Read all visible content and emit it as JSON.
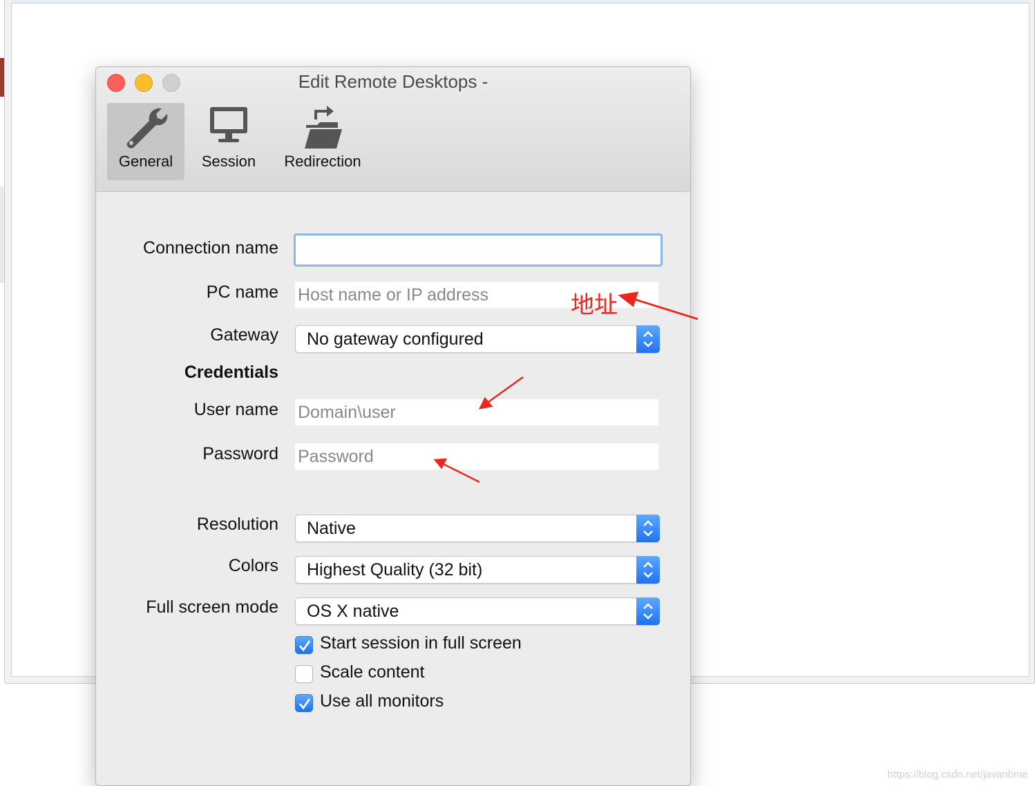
{
  "window": {
    "title": "Edit Remote Desktops -"
  },
  "toolbar": {
    "items": [
      {
        "label": "General",
        "icon": "wrench-icon",
        "active": true
      },
      {
        "label": "Session",
        "icon": "monitor-icon",
        "active": false
      },
      {
        "label": "Redirection",
        "icon": "folder-redirect-icon",
        "active": false
      }
    ]
  },
  "form": {
    "connection_name": {
      "label": "Connection name",
      "value": "",
      "placeholder": ""
    },
    "pc_name": {
      "label": "PC name",
      "value": "",
      "placeholder": "Host name or IP address"
    },
    "gateway": {
      "label": "Gateway",
      "value": "No gateway configured"
    },
    "credentials_heading": "Credentials",
    "user_name": {
      "label": "User name",
      "value": "",
      "placeholder": "Domain\\user"
    },
    "password": {
      "label": "Password",
      "value": "",
      "placeholder": "Password"
    },
    "resolution": {
      "label": "Resolution",
      "value": "Native"
    },
    "colors": {
      "label": "Colors",
      "value": "Highest Quality (32 bit)"
    },
    "full_screen_mode": {
      "label": "Full screen mode",
      "value": "OS X native"
    },
    "checkboxes": [
      {
        "label": "Start session in full screen",
        "checked": true
      },
      {
        "label": "Scale content",
        "checked": false
      },
      {
        "label": "Use all monitors",
        "checked": true
      }
    ]
  },
  "annotation": {
    "text": "地址",
    "color": "#e8281e"
  },
  "watermark": "https://blog.csdn.net/javanbme",
  "colors": {
    "accent": "#1f72f0",
    "focus_ring": "#8db6ec",
    "close": "#fc5f57",
    "minimize": "#fdbc2e"
  }
}
